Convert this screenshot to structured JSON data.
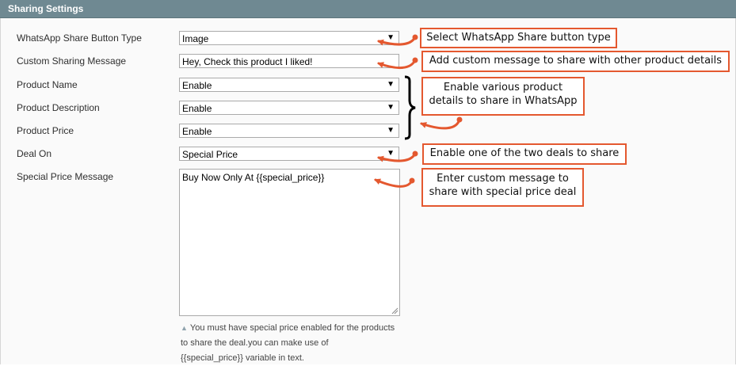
{
  "header": {
    "title": "Sharing Settings"
  },
  "form": {
    "button_type": {
      "label": "WhatsApp Share Button Type",
      "value": "Image"
    },
    "custom_message": {
      "label": "Custom Sharing Message",
      "value": "Hey, Check this product I liked!"
    },
    "product_name": {
      "label": "Product Name",
      "value": "Enable"
    },
    "product_description": {
      "label": "Product Description",
      "value": "Enable"
    },
    "product_price": {
      "label": "Product Price",
      "value": "Enable"
    },
    "deal_on": {
      "label": "Deal On",
      "value": "Special Price"
    },
    "special_price_message": {
      "label": "Special Price Message",
      "value": "Buy Now Only At {{special_price}}"
    },
    "note_line1": "You must have special price enabled for the products",
    "note_line2": "to share the deal.you can make use of",
    "note_line3": "{{special_price}} variable in text."
  },
  "icons": {
    "select_arrow": "▼",
    "note_icon": "▲"
  },
  "callouts": {
    "button_type": "Select WhatsApp Share button type",
    "custom_message": "Add custom message to share with other product details",
    "details_line1": "Enable various product",
    "details_line2": "details to share in WhatsApp",
    "deal": "Enable one of the two deals to share",
    "special_line1": "Enter custom message to",
    "special_line2": "share with special price deal"
  },
  "colors": {
    "header": "#6f8992",
    "accent": "#e4582f",
    "panel": "#fafafa"
  }
}
